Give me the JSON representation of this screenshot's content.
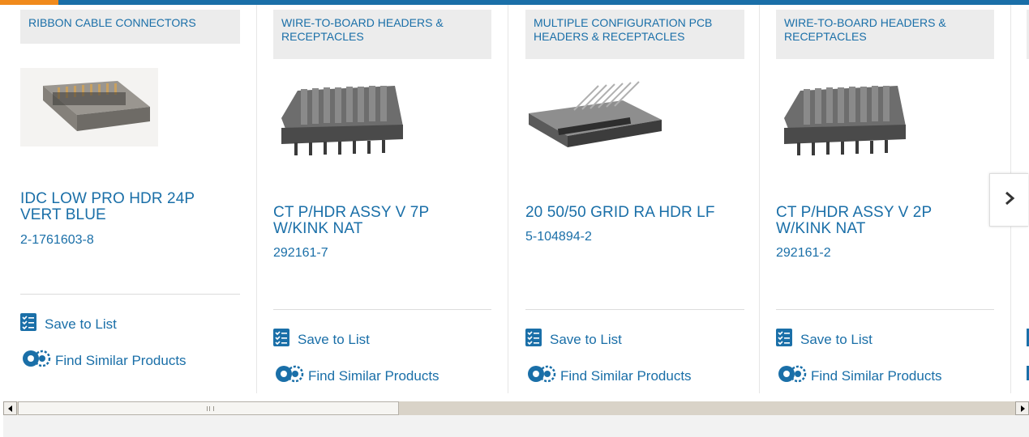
{
  "carousel": {
    "cards": [
      {
        "category": "RIBBON CABLE CONNECTORS",
        "image_icon": "ribbon-connector-image",
        "title": "IDC LOW PRO HDR 24P VERT BLUE",
        "part_number": "2-1761603-8",
        "save_label": "Save to List",
        "similar_label": "Find Similar Products"
      },
      {
        "category": "WIRE-TO-BOARD HEADERS & RECEPTACLES",
        "image_icon": "pin-header-image",
        "title": "CT P/HDR ASSY V 7P W/KINK NAT",
        "part_number": "292161-7",
        "save_label": "Save to List",
        "similar_label": "Find Similar Products"
      },
      {
        "category": "MULTIPLE CONFIGURATION PCB HEADERS & RECEPTACLES",
        "image_icon": "ra-header-image",
        "title": "20 50/50 GRID RA HDR LF",
        "part_number": "5-104894-2",
        "save_label": "Save to List",
        "similar_label": "Find Similar Products"
      },
      {
        "category": "WIRE-TO-BOARD HEADERS & RECEPTACLES",
        "image_icon": "pin-header-image",
        "title": "CT P/HDR ASSY V 2P W/KINK NAT",
        "part_number": "292161-2",
        "save_label": "Save to List",
        "similar_label": "Find Similar Products"
      }
    ],
    "next_icon": "chevron-right-icon"
  },
  "colors": {
    "link_blue": "#1a6fa8",
    "accent_orange": "#f08a1c",
    "category_bg": "#ececec"
  },
  "scrollbar": {
    "left_icon": "scroll-left-arrow",
    "right_icon": "scroll-right-arrow"
  }
}
